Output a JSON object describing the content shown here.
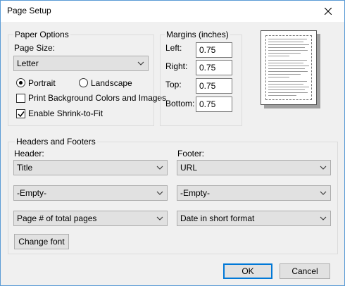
{
  "window": {
    "title": "Page Setup"
  },
  "paper_options": {
    "legend": "Paper Options",
    "page_size_label": "Page Size:",
    "page_size_value": "Letter",
    "portrait_label": "Portrait",
    "landscape_label": "Landscape",
    "orientation": "portrait",
    "print_bg_label": "Print Background Colors and Images",
    "print_bg_checked": false,
    "shrink_label": "Enable Shrink-to-Fit",
    "shrink_checked": true
  },
  "margins": {
    "legend": "Margins (inches)",
    "left_label": "Left:",
    "left_value": "0.75",
    "right_label": "Right:",
    "right_value": "0.75",
    "top_label": "Top:",
    "top_value": "0.75",
    "bottom_label": "Bottom:",
    "bottom_value": "0.75"
  },
  "headers_footers": {
    "legend": "Headers and Footers",
    "header_label": "Header:",
    "footer_label": "Footer:",
    "header_1": "Title",
    "header_2": "-Empty-",
    "header_3": "Page # of total pages",
    "footer_1": "URL",
    "footer_2": "-Empty-",
    "footer_3": "Date in short format",
    "change_font_label": "Change font"
  },
  "buttons": {
    "ok_label": "OK",
    "cancel_label": "Cancel"
  },
  "colors": {
    "window_border": "#5b9bd5",
    "default_button_border": "#0078d7"
  }
}
